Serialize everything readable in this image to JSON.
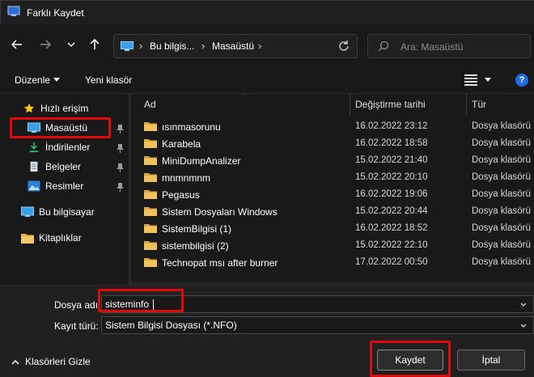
{
  "window": {
    "title": "Farklı Kaydet"
  },
  "address": {
    "crumbs": [
      "Bu bilgis...",
      "Masaüstü"
    ],
    "search_placeholder": "Ara: Masaüstü"
  },
  "toolbar": {
    "organize_label": "Düzenle",
    "new_folder_label": "Yeni klasör",
    "help_label": "?"
  },
  "sidebar": {
    "items": [
      {
        "label": "Hızlı erişim",
        "icon": "star-icon"
      },
      {
        "label": "Masaüstü",
        "icon": "desktop-icon",
        "pinned": true
      },
      {
        "label": "İndirilenler",
        "icon": "download-icon",
        "pinned": true
      },
      {
        "label": "Belgeler",
        "icon": "documents-icon",
        "pinned": true
      },
      {
        "label": "Resimler",
        "icon": "pictures-icon",
        "pinned": true
      },
      {
        "label": "Bu bilgisayar",
        "icon": "computer-icon"
      },
      {
        "label": "Kitaplıklar",
        "icon": "libraries-icon"
      }
    ]
  },
  "filelist": {
    "columns": [
      "Ad",
      "Değiştirme tarihi",
      "Tür"
    ],
    "rows": [
      {
        "name": "ısınmasorunu",
        "date": "16.02.2022 23:12",
        "type": "Dosya klasörü"
      },
      {
        "name": "Karabela",
        "date": "16.02.2022 18:58",
        "type": "Dosya klasörü"
      },
      {
        "name": "MiniDumpAnalizer",
        "date": "15.02.2022 21:40",
        "type": "Dosya klasörü"
      },
      {
        "name": "mnmnmnm",
        "date": "15.02.2022 20:10",
        "type": "Dosya klasörü"
      },
      {
        "name": "Pegasus",
        "date": "16.02.2022 19:06",
        "type": "Dosya klasörü"
      },
      {
        "name": "Sistem Dosyaları Windows",
        "date": "15.02.2022 20:44",
        "type": "Dosya klasörü"
      },
      {
        "name": "SistemBilgisi (1)",
        "date": "16.02.2022 18:52",
        "type": "Dosya klasörü"
      },
      {
        "name": "sistembilgisi (2)",
        "date": "15.02.2022 22:10",
        "type": "Dosya klasörü"
      },
      {
        "name": "Technopat msı after burner",
        "date": "17.02.2022 00:50",
        "type": "Dosya klasörü"
      }
    ]
  },
  "form": {
    "filename_label": "Dosya adı:",
    "filename_value": "sisteminfo",
    "filetype_label": "Kayıt türü:",
    "filetype_value": "Sistem Bilgisi Dosyası (*.NFO)"
  },
  "footer": {
    "hide_folders_label": "Klasörleri Gizle",
    "save_label": "Kaydet",
    "cancel_label": "İptal"
  },
  "colors": {
    "highlight": "#e00a0a",
    "folder": "#e8b54a",
    "accent": "#1d6fe0"
  }
}
